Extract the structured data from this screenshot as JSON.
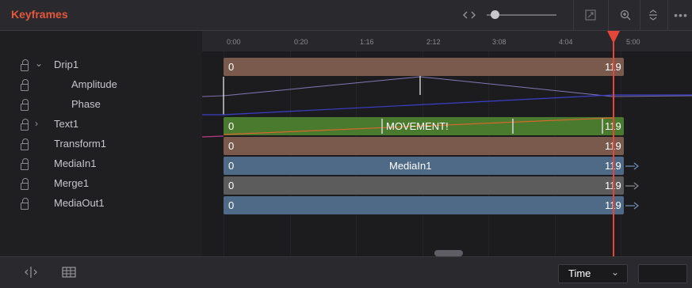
{
  "panel": {
    "title": "Keyframes"
  },
  "header_icons": [
    "code-arrows-icon",
    "zoom-slider",
    "fit-icon",
    "zoom-in-icon",
    "expand-collapse-icon",
    "more-options-icon"
  ],
  "ruler": {
    "ticks": [
      "0:00",
      "0:20",
      "1:16",
      "2:12",
      "3:08",
      "4:04",
      "5:00"
    ]
  },
  "tree": {
    "items": [
      {
        "label": "Drip1",
        "expanded": true
      },
      {
        "label": "Amplitude"
      },
      {
        "label": "Phase"
      },
      {
        "label": "Text1",
        "expanded": false
      },
      {
        "label": "Transform1"
      },
      {
        "label": "MediaIn1"
      },
      {
        "label": "Merge1"
      },
      {
        "label": "MediaOut1"
      }
    ]
  },
  "tracks": {
    "drip1": {
      "start": "0",
      "end": "119"
    },
    "text1": {
      "start": "0",
      "end": "119",
      "center": "MOVEMENT!"
    },
    "transform1": {
      "start": "0",
      "end": "119"
    },
    "mediain1": {
      "start": "0",
      "end": "119",
      "center": "MediaIn1"
    },
    "merge1": {
      "start": "0",
      "end": "119"
    },
    "mediaout1": {
      "start": "0",
      "end": "119"
    }
  },
  "footer": {
    "time_mode": "Time",
    "time_value": ""
  },
  "colors": {
    "accent": "#e5573c",
    "drip_bar": "#7a5a4c",
    "text_bar": "#4a7a2e",
    "transform_bar": "#7a5a4c",
    "mediain_bar": "#4f6a86",
    "merge_bar": "#5c5c5c",
    "mediaout_bar": "#4f6a86"
  }
}
